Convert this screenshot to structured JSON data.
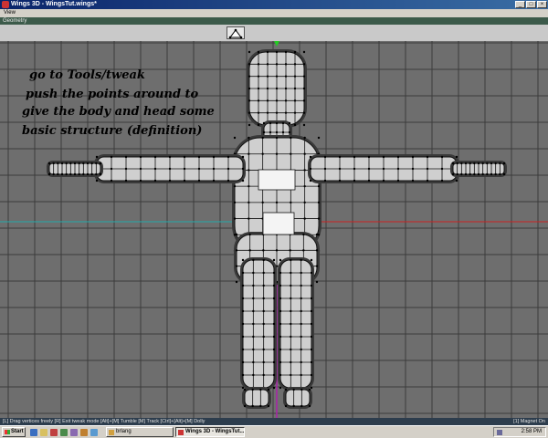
{
  "window": {
    "title": "Wings 3D - WingsTut.wings*"
  },
  "menu": {
    "items": [
      "View"
    ]
  },
  "geometry_label": "Geometry",
  "annotation": {
    "line1": "go to Tools/tweak",
    "line2": "push the points around to",
    "line3": "give the body and head some",
    "line4": "basic structure (definition)"
  },
  "statusbar": {
    "hint": "[L] Drag vertices freely  [R] Exit tweak mode  [Alt]+[M] Tumble  [M] Track  [Ctrl]+[Alt]+[M] Dolly",
    "magnet": "[1] Magnet On"
  },
  "taskbar": {
    "start": "Start",
    "tasks": [
      {
        "label": "brlang",
        "active": false
      },
      {
        "label": "Wings 3D - WingsTut...",
        "active": true
      }
    ],
    "clock": "2:58 PM"
  },
  "colors": {
    "viewport_bg": "#6e6e6e",
    "grid": "#3c3c3c",
    "x_axis": "#cc2222",
    "z_axis": "#22aaaa",
    "y_axis": "#aa22aa",
    "mesh_fill": "#cfcfcf",
    "mesh_edge": "#111111",
    "titlebar": "#0a246a"
  },
  "icons": [
    "wings-app-icon",
    "vertex-mode-icon",
    "windows-logo-icon",
    "minimize-icon",
    "maximize-icon",
    "close-icon"
  ]
}
